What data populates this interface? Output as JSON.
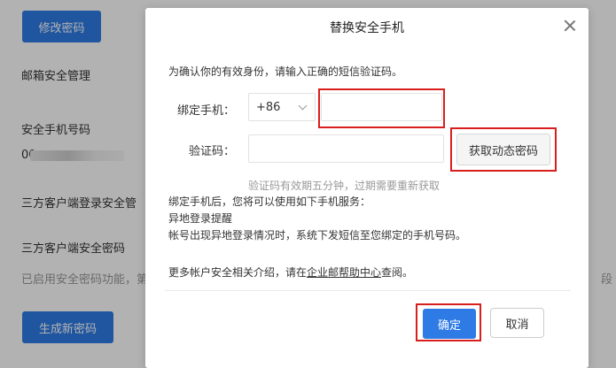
{
  "background": {
    "change_password_button": "修改密码",
    "mailbox_security": "邮箱安全管理",
    "phone_label": "安全手机号码",
    "phone_value_prefix": "00",
    "third_party_login": "三方客户端登录安全管",
    "third_party_password": "三方客户端安全密码",
    "password_enabled_text": "已启用安全密码功能，第",
    "right_edge_text": "段",
    "generate_password_button": "生成新密码"
  },
  "dialog": {
    "title": "替换安全手机",
    "intro": "为确认你的有效身份，请输入正确的短信验证码。",
    "bind_phone_label": "绑定手机：",
    "country_code": "+86",
    "phone_value": "",
    "code_label": "验证码：",
    "code_value": "",
    "get_code_button": "获取动态密码",
    "code_hint": "验证码有效期五分钟，过期需要重新获取",
    "info_line_1": "绑定手机后，您将可以使用如下手机服务：",
    "info_line_2": "异地登录提醒",
    "info_line_3": "帐号出现异地登录情况时，系统下发短信至您绑定的手机号码。",
    "more_prefix": "更多帐户安全相关介绍，请在",
    "more_link": "企业邮帮助中心",
    "more_suffix": "查阅。",
    "confirm_button": "确定",
    "cancel_button": "取消"
  },
  "colors": {
    "primary": "#2e7be6",
    "highlight_box": "#d91e1e",
    "overlay": "rgba(0,0,0,0.30)"
  },
  "icons": {
    "close": "close-icon",
    "dropdown": "chevron-down-icon"
  }
}
